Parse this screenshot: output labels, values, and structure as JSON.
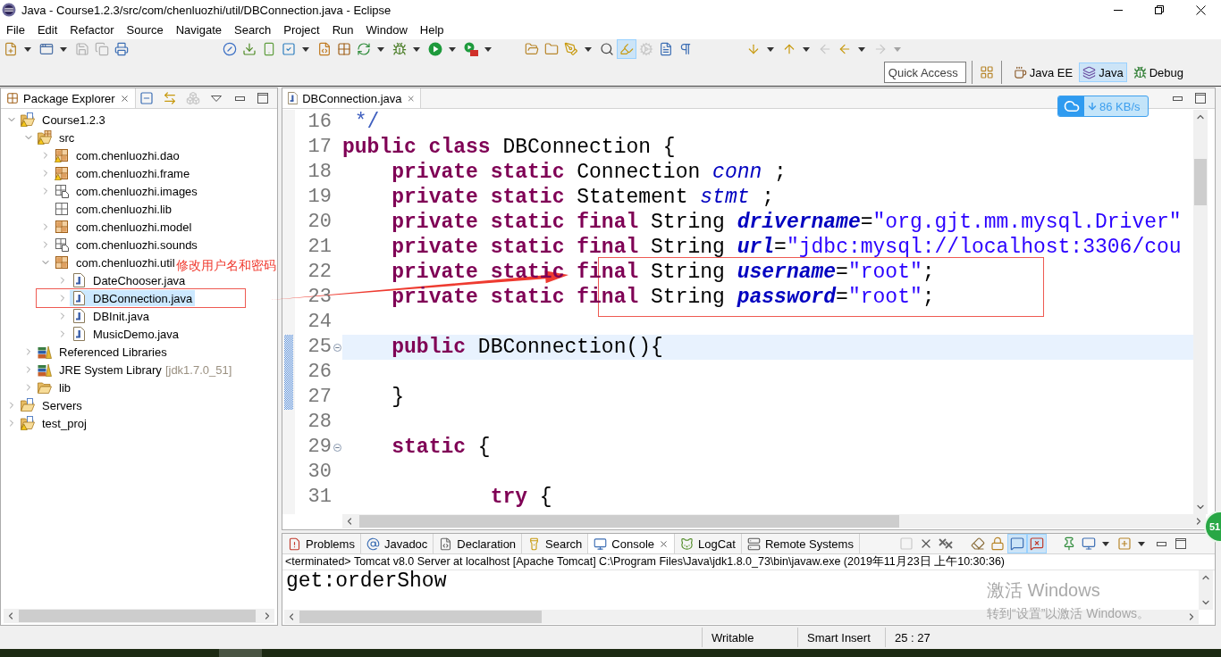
{
  "window": {
    "title": "Java - Course1.2.3/src/com/chenluozhi/util/DBConnection.java - Eclipse"
  },
  "menu": [
    "File",
    "Edit",
    "Refactor",
    "Source",
    "Navigate",
    "Search",
    "Project",
    "Run",
    "Window",
    "Help"
  ],
  "main_toolbar": {
    "groups": [
      {
        "buttons": [
          {
            "dropdown": true,
            "disabled": false,
            "pressed": false
          },
          {
            "dropdown": true,
            "disabled": false,
            "pressed": false
          },
          {
            "dropdown": false,
            "disabled": true,
            "pressed": false
          },
          {
            "dropdown": false,
            "disabled": true,
            "pressed": false
          },
          {
            "dropdown": false,
            "disabled": false,
            "pressed": false
          }
        ]
      },
      {
        "buttons": [
          {
            "dropdown": false,
            "disabled": false,
            "pressed": false
          },
          {
            "dropdown": false,
            "disabled": false,
            "pressed": false
          },
          {
            "dropdown": false,
            "disabled": false,
            "pressed": false
          },
          {
            "dropdown": true,
            "disabled": false,
            "pressed": false
          },
          {
            "dropdown": false,
            "disabled": false,
            "pressed": false
          },
          {
            "dropdown": false,
            "disabled": false,
            "pressed": false
          },
          {
            "dropdown": true,
            "disabled": false,
            "pressed": false
          },
          {
            "dropdown": true,
            "disabled": false,
            "pressed": false
          },
          {
            "dropdown": true,
            "disabled": false,
            "pressed": false
          },
          {
            "dropdown": true,
            "disabled": false,
            "pressed": false
          }
        ]
      },
      {
        "buttons": [
          {
            "dropdown": false,
            "disabled": false,
            "pressed": false
          },
          {
            "dropdown": false,
            "disabled": false,
            "pressed": false
          },
          {
            "dropdown": true,
            "disabled": false,
            "pressed": false
          },
          {
            "dropdown": false,
            "disabled": false,
            "pressed": false
          },
          {
            "dropdown": false,
            "disabled": false,
            "pressed": true
          },
          {
            "dropdown": false,
            "disabled": true,
            "pressed": false
          },
          {
            "dropdown": false,
            "disabled": false,
            "pressed": false
          },
          {
            "dropdown": false,
            "disabled": false,
            "pressed": false
          }
        ]
      },
      {
        "buttons": [
          {
            "dropdown": true,
            "disabled": false,
            "pressed": false
          },
          {
            "dropdown": true,
            "disabled": false,
            "pressed": false
          },
          {
            "dropdown": false,
            "disabled": true,
            "pressed": false
          },
          {
            "dropdown": true,
            "disabled": false,
            "pressed": false
          },
          {
            "dropdown": true,
            "disabled": true,
            "pressed": false
          }
        ]
      }
    ]
  },
  "quick_access": {
    "placeholder": "Quick Access"
  },
  "perspectives": [
    {
      "label": "Java EE",
      "selected": false
    },
    {
      "label": "Java",
      "selected": true
    },
    {
      "label": "Debug",
      "selected": false
    }
  ],
  "package_explorer": {
    "title": "Package Explorer",
    "toolbar": [
      {
        "disabled": false
      },
      {
        "disabled": false
      },
      {
        "disabled": true
      }
    ],
    "tree": [
      {
        "label": "Course1.2.3",
        "kind": "project",
        "warning": true,
        "expanded": true,
        "selected": false,
        "children": [
          {
            "label": "src",
            "kind": "source-folder",
            "warning": true,
            "expanded": true,
            "selected": false,
            "children": [
              {
                "label": "com.chenluozhi.dao",
                "kind": "package",
                "warning": true,
                "expanded": false,
                "selected": false
              },
              {
                "label": "com.chenluozhi.frame",
                "kind": "package",
                "warning": true,
                "expanded": false,
                "selected": false
              },
              {
                "label": "com.chenluozhi.images",
                "kind": "resource-package",
                "warning": false,
                "expanded": false,
                "selected": false
              },
              {
                "label": "com.chenluozhi.lib",
                "kind": "empty-package",
                "warning": false,
                "selected": false
              },
              {
                "label": "com.chenluozhi.model",
                "kind": "package",
                "warning": false,
                "expanded": false,
                "selected": false
              },
              {
                "label": "com.chenluozhi.sounds",
                "kind": "resource-package",
                "warning": false,
                "expanded": false,
                "selected": false
              },
              {
                "label": "com.chenluozhi.util",
                "kind": "package",
                "warning": false,
                "expanded": true,
                "selected": false,
                "children": [
                  {
                    "label": "DateChooser.java",
                    "kind": "java-file",
                    "warning": false,
                    "expanded": false,
                    "selected": false
                  },
                  {
                    "label": "DBConnection.java",
                    "kind": "java-file",
                    "warning": false,
                    "expanded": false,
                    "selected": true
                  },
                  {
                    "label": "DBInit.java",
                    "kind": "java-file",
                    "warning": false,
                    "expanded": false,
                    "selected": false
                  },
                  {
                    "label": "MusicDemo.java",
                    "kind": "java-file",
                    "warning": false,
                    "expanded": false,
                    "selected": false
                  }
                ]
              }
            ]
          },
          {
            "label": "Referenced Libraries",
            "kind": "library",
            "warning": false,
            "expanded": false,
            "selected": false
          },
          {
            "label": "JRE System Library",
            "decoration": "[jdk1.7.0_51]",
            "kind": "library",
            "warning": false,
            "expanded": false,
            "selected": false
          },
          {
            "label": "lib",
            "kind": "folder",
            "warning": false,
            "expanded": false,
            "selected": false
          }
        ]
      },
      {
        "label": "Servers",
        "kind": "project",
        "warning": false,
        "expanded": false,
        "selected": false
      },
      {
        "label": "test_proj",
        "kind": "project",
        "warning": true,
        "expanded": false,
        "selected": false
      }
    ]
  },
  "editor": {
    "tabs": [
      {
        "label": "DBConnection.java",
        "selected": true
      }
    ],
    "lines": [
      {
        "number": "16",
        "current": false,
        "foldable": false,
        "changed": false,
        "tokens": [
          {
            "kind": "comment",
            "text": " */"
          }
        ]
      },
      {
        "number": "17",
        "current": false,
        "foldable": false,
        "changed": false,
        "tokens": [
          {
            "kind": "keyword",
            "text": "public class"
          },
          {
            "kind": "text",
            "text": " DBConnection {"
          }
        ]
      },
      {
        "number": "18",
        "current": false,
        "foldable": false,
        "changed": false,
        "tokens": [
          {
            "kind": "keyword",
            "text": "    private static"
          },
          {
            "kind": "text",
            "text": " Connection "
          },
          {
            "kind": "static-field",
            "text": "conn"
          },
          {
            "kind": "text",
            "text": " ;"
          }
        ]
      },
      {
        "number": "19",
        "current": false,
        "foldable": false,
        "changed": false,
        "tokens": [
          {
            "kind": "keyword",
            "text": "    private static"
          },
          {
            "kind": "text",
            "text": " Statement "
          },
          {
            "kind": "static-field",
            "text": "stmt"
          },
          {
            "kind": "text",
            "text": " ;"
          }
        ]
      },
      {
        "number": "20",
        "current": false,
        "foldable": false,
        "changed": false,
        "tokens": [
          {
            "kind": "keyword",
            "text": "    private static final"
          },
          {
            "kind": "text",
            "text": " String "
          },
          {
            "kind": "constant",
            "text": "drivername"
          },
          {
            "kind": "text",
            "text": "="
          },
          {
            "kind": "string",
            "text": "\"org.gjt.mm.mysql.Driver\""
          }
        ]
      },
      {
        "number": "21",
        "current": false,
        "foldable": false,
        "changed": false,
        "tokens": [
          {
            "kind": "keyword",
            "text": "    private static final"
          },
          {
            "kind": "text",
            "text": " String "
          },
          {
            "kind": "constant",
            "text": "url"
          },
          {
            "kind": "text",
            "text": "="
          },
          {
            "kind": "string",
            "text": "\"jdbc:mysql://localhost:3306/cou"
          }
        ]
      },
      {
        "number": "22",
        "current": false,
        "foldable": false,
        "changed": false,
        "tokens": [
          {
            "kind": "keyword",
            "text": "    private static final"
          },
          {
            "kind": "text",
            "text": " String "
          },
          {
            "kind": "constant",
            "text": "username"
          },
          {
            "kind": "text",
            "text": "="
          },
          {
            "kind": "string",
            "text": "\"root\""
          },
          {
            "kind": "text",
            "text": ";"
          }
        ]
      },
      {
        "number": "23",
        "current": false,
        "foldable": false,
        "changed": false,
        "tokens": [
          {
            "kind": "keyword",
            "text": "    private static final"
          },
          {
            "kind": "text",
            "text": " String "
          },
          {
            "kind": "constant",
            "text": "password"
          },
          {
            "kind": "text",
            "text": "="
          },
          {
            "kind": "string",
            "text": "\"root\""
          },
          {
            "kind": "text",
            "text": ";"
          }
        ]
      },
      {
        "number": "24",
        "current": false,
        "foldable": false,
        "changed": false
      },
      {
        "number": "25",
        "current": true,
        "foldable": true,
        "changed": true,
        "tokens": [
          {
            "kind": "keyword",
            "text": "    public"
          },
          {
            "kind": "text",
            "text": " DBConnection(){"
          }
        ]
      },
      {
        "number": "26",
        "current": false,
        "foldable": false,
        "changed": true
      },
      {
        "number": "27",
        "current": false,
        "foldable": false,
        "changed": true,
        "tokens": [
          {
            "kind": "text",
            "text": "    }"
          }
        ]
      },
      {
        "number": "28",
        "current": false,
        "foldable": false,
        "changed": false
      },
      {
        "number": "29",
        "current": false,
        "foldable": true,
        "changed": false,
        "tokens": [
          {
            "kind": "keyword",
            "text": "    static"
          },
          {
            "kind": "text",
            "text": " {"
          }
        ]
      },
      {
        "number": "30",
        "current": false,
        "foldable": false,
        "changed": false
      },
      {
        "number": "31",
        "current": false,
        "foldable": false,
        "changed": false,
        "tokens": [
          {
            "kind": "keyword",
            "text": "            try"
          },
          {
            "kind": "text",
            "text": " {"
          }
        ]
      }
    ]
  },
  "annotation": {
    "text": "修改用户名和密码"
  },
  "speed_widget": {
    "speed": "86 KB/s"
  },
  "bottom_panel": {
    "tabs": [
      {
        "label": "Problems",
        "selected": false
      },
      {
        "label": "Javadoc",
        "selected": false
      },
      {
        "label": "Declaration",
        "selected": false
      },
      {
        "label": "Search",
        "selected": false
      },
      {
        "label": "Console",
        "selected": true
      },
      {
        "label": "LogCat",
        "selected": false
      },
      {
        "label": "Remote Systems",
        "selected": false
      }
    ],
    "toolbar": {
      "groups": [
        {
          "buttons": [
            {
              "dropdown": false,
              "disabled": true,
              "pressed": false
            },
            {
              "dropdown": false,
              "disabled": false,
              "pressed": false
            },
            {
              "dropdown": false,
              "disabled": false,
              "pressed": false
            }
          ]
        },
        {
          "buttons": [
            {
              "dropdown": false,
              "disabled": false,
              "pressed": false
            },
            {
              "dropdown": false,
              "disabled": false,
              "pressed": false
            },
            {
              "dropdown": false,
              "disabled": false,
              "pressed": true
            },
            {
              "dropdown": false,
              "disabled": false,
              "pressed": true
            }
          ]
        },
        {
          "buttons": [
            {
              "dropdown": false,
              "disabled": false,
              "pressed": false
            },
            {
              "dropdown": true,
              "disabled": false,
              "pressed": false
            },
            {
              "dropdown": true,
              "disabled": false,
              "pressed": false
            }
          ]
        }
      ]
    },
    "console": {
      "header": "<terminated> Tomcat v8.0 Server at localhost [Apache Tomcat] C:\\Program Files\\Java\\jdk1.8.0_73\\bin\\javaw.exe (2019年11月23日 上午10:30:36)",
      "output": "get:orderShow"
    }
  },
  "status_bar": [
    "Writable",
    "Smart Insert",
    "25 : 27"
  ],
  "floating_ball": {
    "text": "51"
  },
  "activation_notice": {
    "title": "激活 Windows",
    "message": "转到“设置”以激活 Windows。"
  }
}
